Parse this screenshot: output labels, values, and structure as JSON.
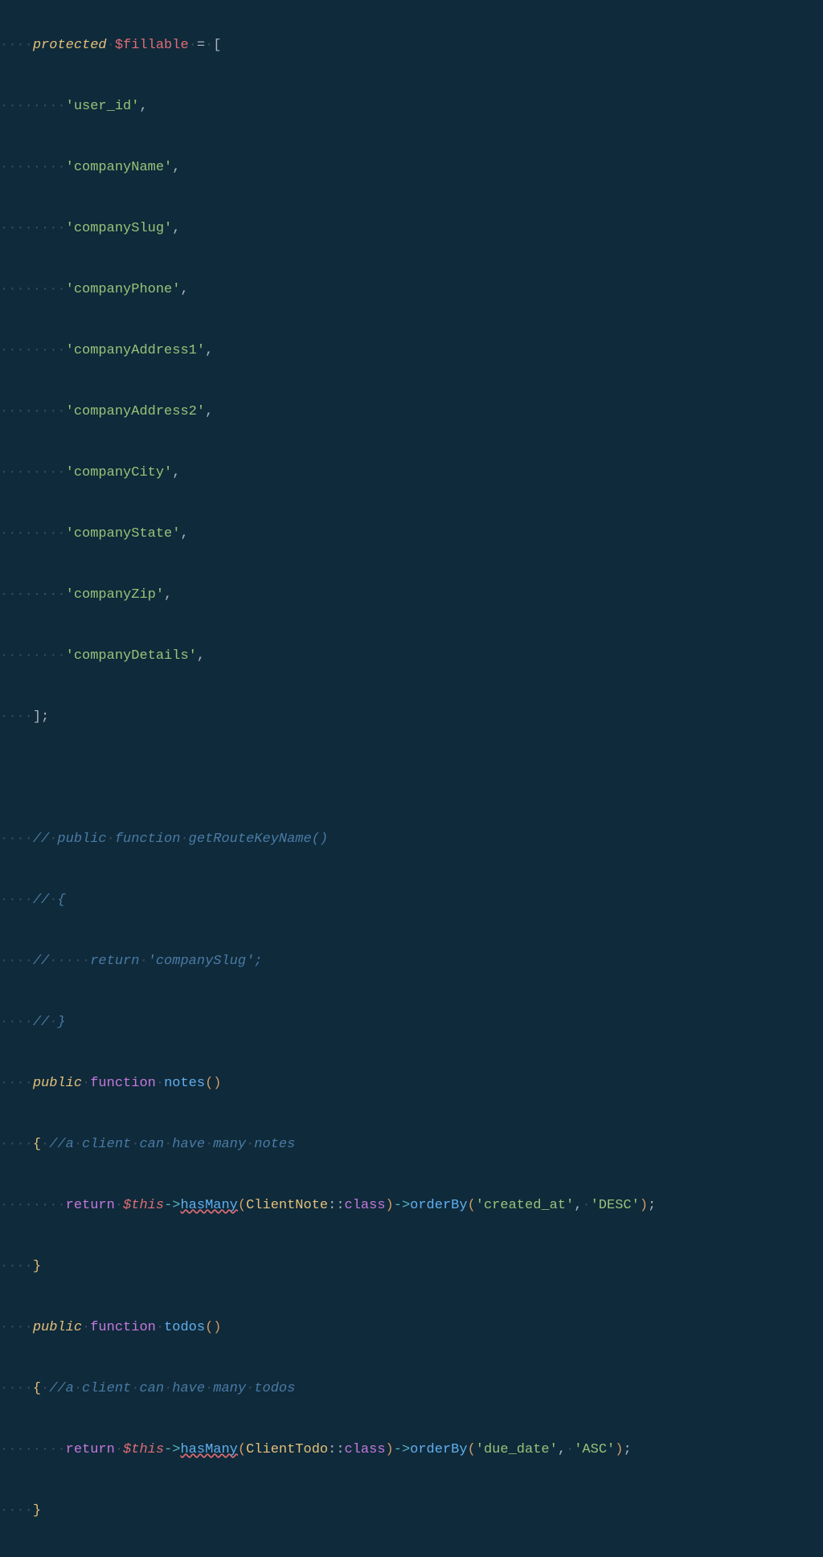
{
  "code": {
    "protected": "protected",
    "fillable_var": "$fillable",
    "equals": "=",
    "open_bracket": "[",
    "fields": [
      "'user_id'",
      "'companyName'",
      "'companySlug'",
      "'companyPhone'",
      "'companyAddress1'",
      "'companyAddress2'",
      "'companyCity'",
      "'companyState'",
      "'companyZip'",
      "'companyDetails'"
    ],
    "close_bracket": "];",
    "comment1": "// public function getRouteKeyName()",
    "comment2": "// {",
    "comment3": "//     return 'companySlug';",
    "comment4": "// }",
    "public": "public",
    "function": "function",
    "notes_name": "notes",
    "todos_name": "todos",
    "open_paren": "(",
    "close_paren": ")",
    "open_brace": "{",
    "close_brace": "}",
    "notes_comment": "//a client can have many notes",
    "todos_comment": "//a client can have many todos",
    "return": "return",
    "this": "$this",
    "arrow": "->",
    "hasMany": "hasMany",
    "clientNote": "ClientNote",
    "clientTodo": "ClientTodo",
    "scope": "::",
    "class_kw": "class",
    "orderBy": "orderBy",
    "created_at": "'created_at'",
    "desc": "'DESC'",
    "due_date": "'due_date'",
    "asc": "'ASC'",
    "comma": ",",
    "semi": ";",
    "ws4": "····",
    "ws8": "········",
    "ws1": "·"
  }
}
